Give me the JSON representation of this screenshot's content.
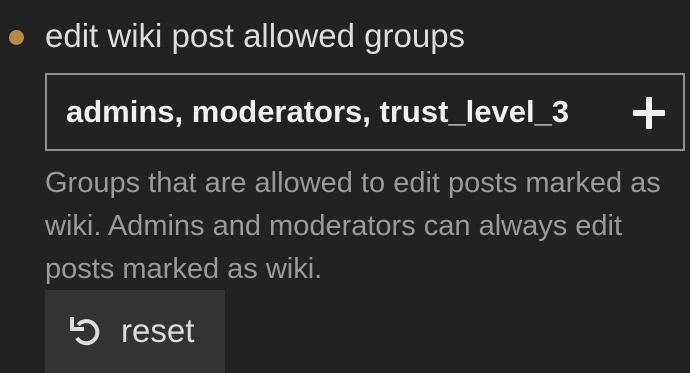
{
  "setting": {
    "title": "edit wiki post allowed groups",
    "bullet_color": "#b88a45",
    "groups_value": "admins, moderators, trust_level_3",
    "add_icon": "plus-icon",
    "description": "Groups that are allowed to edit posts marked as wiki. Admins and moderators can always edit posts marked as wiki.",
    "reset_icon": "undo-icon",
    "reset_label": "reset"
  }
}
